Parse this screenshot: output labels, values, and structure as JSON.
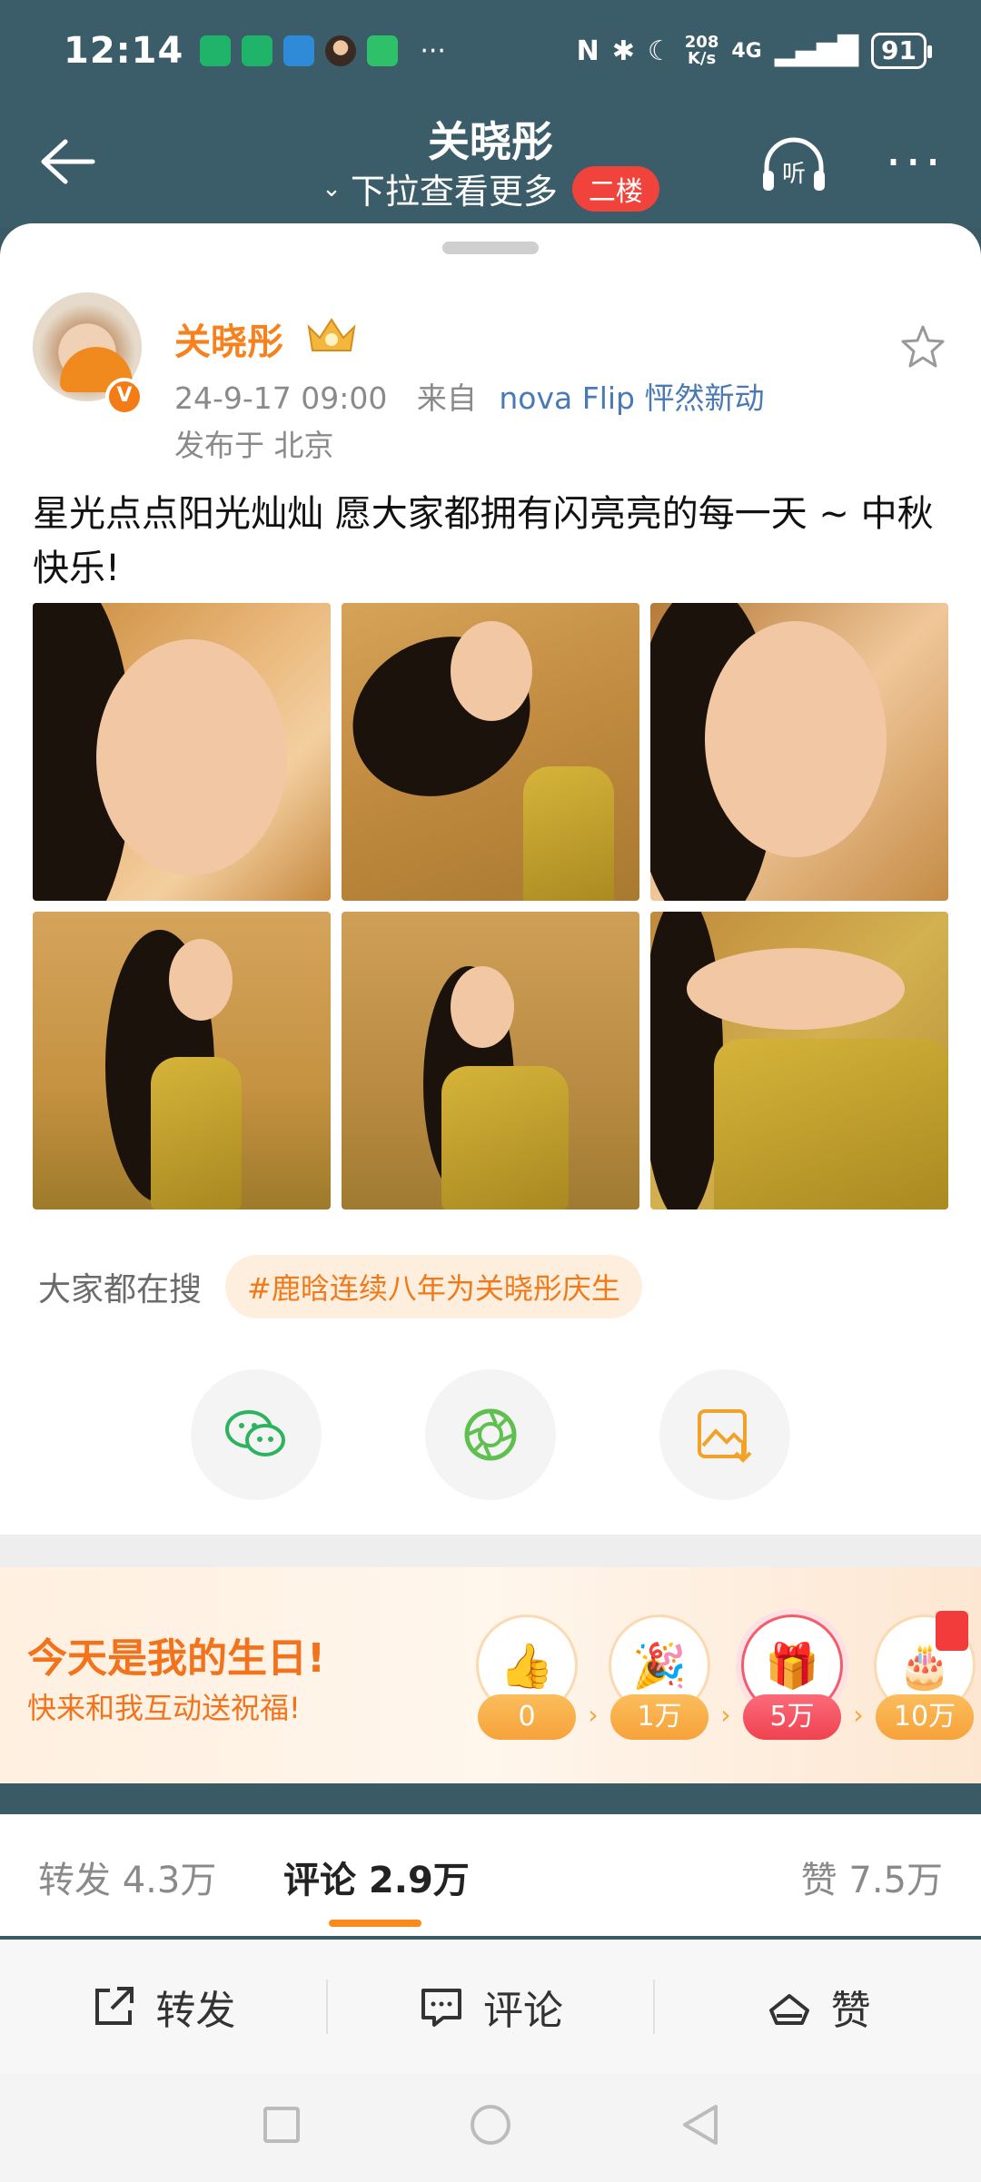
{
  "status_bar": {
    "time": "12:14",
    "more": "···",
    "net_speed_value": "208",
    "net_speed_unit": "K/s",
    "signal": "4G",
    "battery": "91"
  },
  "header": {
    "title": "关晓彤",
    "subtitle": "下拉查看更多",
    "floor_badge": "二楼",
    "listen_label": "听",
    "more": "···"
  },
  "post": {
    "author": "关晓彤",
    "verified_badge": "V",
    "time": "24-9-17 09:00",
    "source_prefix": "来自",
    "source": "nova Flip 怦然新动",
    "location": "发布于 北京",
    "text": "星光点点阳光灿灿 愿大家都拥有闪亮亮的每一天 ~ 中秋快乐!",
    "photo_count": 6
  },
  "hot_search": {
    "label": "大家都在搜",
    "tag": "#鹿晗连续八年为关晓彤庆生"
  },
  "share_buttons": [
    "wechat-icon",
    "moments-icon",
    "save-image-icon"
  ],
  "birthday": {
    "title": "今天是我的生日!",
    "subtitle": "快来和我互动送祝福!",
    "tiers": [
      {
        "icon": "👍",
        "value": "0"
      },
      {
        "icon": "🎉",
        "value": "1万"
      },
      {
        "icon": "🎁",
        "value": "5万"
      },
      {
        "icon": "🎂",
        "value": "10万"
      }
    ],
    "active_tier": 2
  },
  "tabs": {
    "repost": "转发 4.3万",
    "comment": "评论 2.9万",
    "like": "赞 7.5万"
  },
  "actions": {
    "repost": "转发",
    "comment": "评论",
    "like": "赞"
  },
  "colors": {
    "header_bg": "#3b5c69",
    "accent_orange": "#f6821f",
    "floor_red": "#f0433b",
    "link_blue": "#4a7ab6"
  }
}
